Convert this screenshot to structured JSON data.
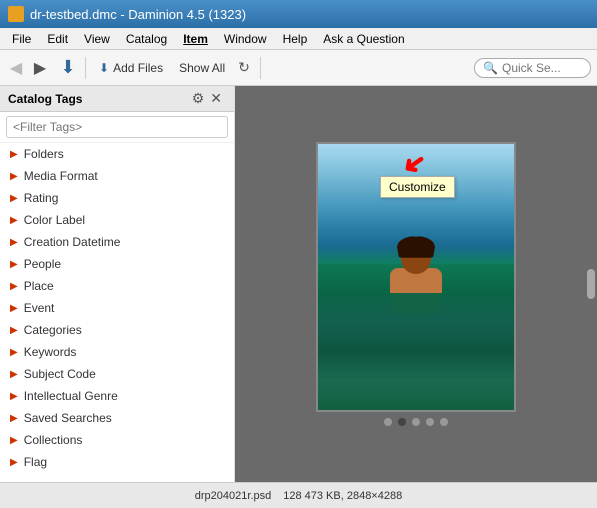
{
  "window": {
    "title": "dr-testbed.dmc - Daminion 4.5 (1323)",
    "icon_label": "app-icon"
  },
  "menu": {
    "items": [
      "File",
      "Edit",
      "View",
      "Catalog",
      "Item",
      "Window",
      "Help",
      "Ask a Question"
    ]
  },
  "toolbar": {
    "back_label": "◀",
    "forward_label": "▶",
    "download_label": "⬇",
    "add_files_label": "Add Files",
    "show_all_label": "Show All",
    "refresh_label": "↻",
    "quick_search_placeholder": "Quick Se..."
  },
  "sidebar": {
    "title": "Catalog Tags",
    "filter_placeholder": "<Filter Tags>",
    "close_label": "✕",
    "gear_label": "⚙",
    "tags": [
      "Folders",
      "Media Format",
      "Rating",
      "Color Label",
      "Creation Datetime",
      "People",
      "Place",
      "Event",
      "Categories",
      "Keywords",
      "Subject Code",
      "Intellectual Genre",
      "Saved Searches",
      "Collections",
      "Flag"
    ]
  },
  "tooltip": {
    "text": "Customize"
  },
  "image": {
    "filename": "drp204021r.psd",
    "filesize": "128 473 KB, 2848×4288"
  },
  "statusbar": {
    "filename": "drp204021r.psd",
    "info": "128 473 KB, 2848×4288"
  },
  "colors": {
    "accent_red": "#cc3300",
    "link_blue": "#336699",
    "bg_toolbar": "#f5f5f5",
    "bg_sidebar": "#ffffff",
    "bg_panel": "#6a6a6a"
  }
}
